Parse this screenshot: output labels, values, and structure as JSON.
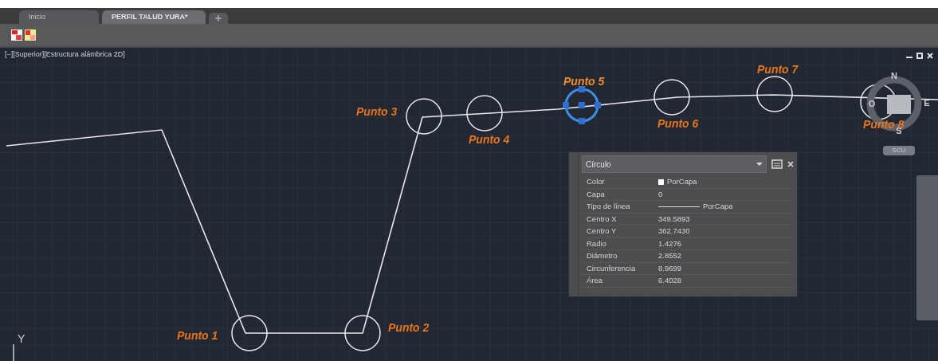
{
  "tabs": [
    {
      "label": "Inicio",
      "selected": false
    },
    {
      "label": "PERFIL TALUD YURA*",
      "selected": true
    }
  ],
  "viewport_label": "[−][Superior][Estructura alámbrica 2D]",
  "points": [
    {
      "label": "Punto 1",
      "selected": false
    },
    {
      "label": "Punto 2",
      "selected": false
    },
    {
      "label": "Punto 3",
      "selected": false
    },
    {
      "label": "Punto 4",
      "selected": false
    },
    {
      "label": "Punto 5",
      "selected": true
    },
    {
      "label": "Punto 6",
      "selected": false
    },
    {
      "label": "Punto 7",
      "selected": false
    },
    {
      "label": "Punto 8",
      "selected": false
    }
  ],
  "viewcube": {
    "north": "N",
    "east": "E",
    "south": "S",
    "west": "O",
    "ucs_button": "SCU"
  },
  "ucs_axis": "Y",
  "properties": {
    "object_type": "Círculo",
    "rows": [
      {
        "label": "Color",
        "value": "PorCapa",
        "kind": "color",
        "color": "#ffffff"
      },
      {
        "label": "Capa",
        "value": "0",
        "kind": "text"
      },
      {
        "label": "Tipo de línea",
        "value": "PorCapa",
        "kind": "linetype"
      },
      {
        "label": "Centro X",
        "value": "349.5893",
        "kind": "text"
      },
      {
        "label": "Centro Y",
        "value": "362.7430",
        "kind": "text"
      },
      {
        "label": "Radio",
        "value": "1.4276",
        "kind": "text"
      },
      {
        "label": "Diámetro",
        "value": "2.8552",
        "kind": "text"
      },
      {
        "label": "Circunferencia",
        "value": "8.9699",
        "kind": "text"
      },
      {
        "label": "Área",
        "value": "6.4028",
        "kind": "text"
      }
    ]
  }
}
